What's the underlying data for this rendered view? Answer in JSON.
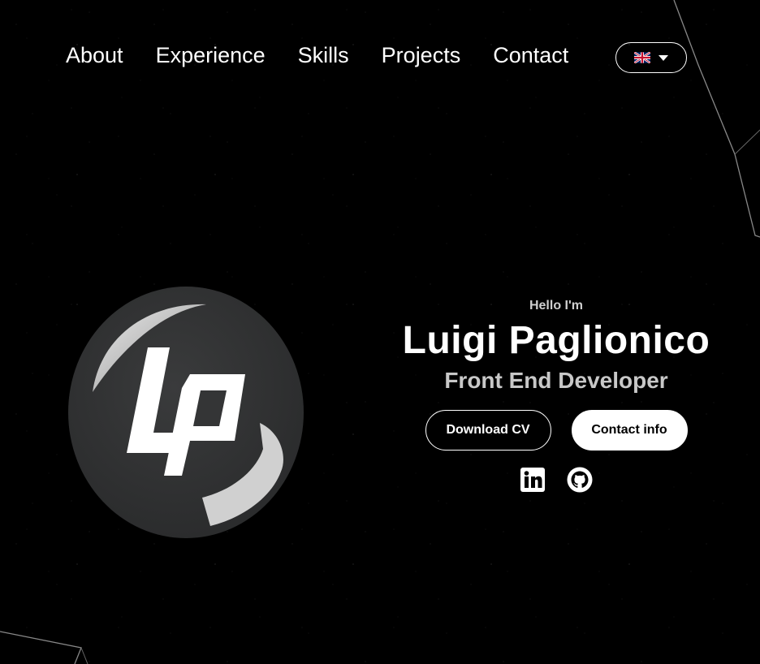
{
  "nav": {
    "items": [
      "About",
      "Experience",
      "Skills",
      "Projects",
      "Contact"
    ]
  },
  "language": {
    "icon": "uk-flag-icon",
    "caret_icon": "caret-down-icon"
  },
  "hero": {
    "greeting": "Hello I'm",
    "name": "Luigi Paglionico",
    "role": "Front End Developer",
    "download_label": "Download CV",
    "contact_label": "Contact info"
  },
  "socials": [
    {
      "icon": "linkedin-icon"
    },
    {
      "icon": "github-icon"
    }
  ],
  "colors": {
    "background": "#000000",
    "text": "#ffffff",
    "subtext": "#c8c8c8"
  }
}
